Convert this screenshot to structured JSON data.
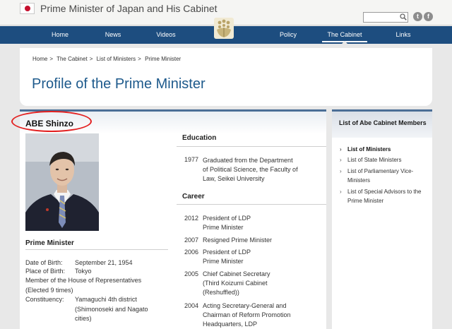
{
  "header": {
    "site_title": "Prime Minister of Japan and His Cabinet",
    "search_placeholder": ""
  },
  "nav": {
    "items": [
      {
        "label": "Home"
      },
      {
        "label": "News"
      },
      {
        "label": "Videos"
      },
      {
        "label": "Policy"
      },
      {
        "label": "The Cabinet"
      },
      {
        "label": "Links"
      }
    ],
    "active": "The Cabinet"
  },
  "breadcrumb": [
    "Home",
    "The Cabinet",
    "List of Ministers",
    "Prime Minister"
  ],
  "breadcrumb_separator": ">",
  "page_title": "Profile of the Prime Minister",
  "profile": {
    "name": "ABE Shinzo",
    "role": "Prime Minister",
    "bio": {
      "dob_label": "Date of Birth:",
      "dob_value": "September 21, 1954",
      "pob_label": "Place of Birth:",
      "pob_value": "Tokyo",
      "member_line1": "Member of the House of Representatives",
      "member_line2": "(Elected 9 times)",
      "constituency_label": "Constituency:",
      "constituency_value1": "Yamaguchi 4th district",
      "constituency_value2": "(Shimonoseki and Nagato",
      "constituency_value3": "cities)"
    },
    "education_heading": "Education",
    "education": [
      {
        "year": "1977",
        "lines": [
          "Graduated from the Department",
          "of Political Science, the Faculty of",
          "Law, Seikei University"
        ]
      }
    ],
    "career_heading": "Career",
    "career": [
      {
        "year": "2012",
        "lines": [
          "President of LDP",
          "Prime Minister"
        ]
      },
      {
        "year": "2007",
        "lines": [
          "Resigned Prime Minister"
        ]
      },
      {
        "year": "2006",
        "lines": [
          "President of LDP",
          "Prime Minister"
        ]
      },
      {
        "year": "2005",
        "lines": [
          "Chief Cabinet Secretary",
          "(Third Koizumi Cabinet",
          "(Reshuffled))"
        ]
      },
      {
        "year": "2004",
        "lines": [
          "Acting Secretary-General and",
          "Chairman of Reform Promotion",
          "Headquarters, LDP"
        ]
      }
    ]
  },
  "sidebar": {
    "title": "List of Abe Cabinet Members",
    "links": [
      "List of Ministers",
      "List of State Ministers",
      "List of Parliamentary Vice-Ministers",
      "List of Special Advisors to the Prime Minister"
    ]
  },
  "colors": {
    "nav_bg": "#1d4d7f",
    "title_blue": "#1e5a8c",
    "annotation_red": "#e32020",
    "flag_red": "#c6102e"
  }
}
